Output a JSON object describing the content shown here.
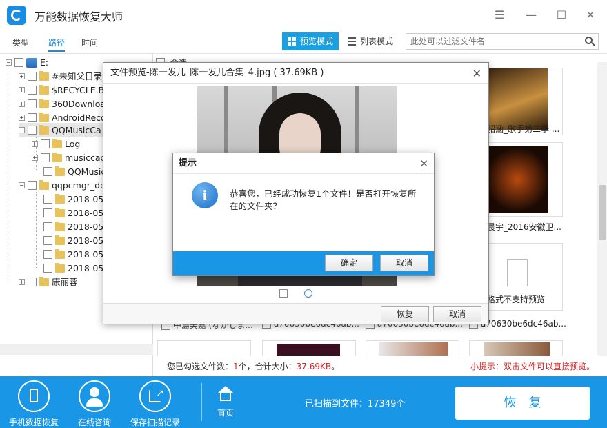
{
  "app": {
    "title": "万能数据恢复大师",
    "colors": {
      "accent": "#1a96e6",
      "warning": "#e02020"
    }
  },
  "toolbar": {
    "tabs": [
      "类型",
      "路径",
      "时间"
    ],
    "active_tab": "路径",
    "mode_preview": "预览模式",
    "mode_list": "列表模式",
    "search_placeholder": "此处可以过滤文件名"
  },
  "tree": {
    "root": "E:",
    "items": [
      "#未知父目录",
      "$RECYCLE.B",
      "360Downloa",
      "AndroidReco",
      "QQMusicCa",
      "Log",
      "musiccac",
      "QQMusic",
      "qqpcmgr_do",
      "2018-05-",
      "2018-05-",
      "2018-05-",
      "2018-05-",
      "2018-05-",
      "2018-05-",
      "康丽蓉"
    ]
  },
  "main": {
    "select_all": "全选",
    "files": [
      "陈一发儿_陈一发儿合集_4.jpg",
      "韶涵_歌手第二季 ...",
      "晨宇_2016安徽卫...",
      "格式不支持预览",
      "中島美嘉 (なかしま...",
      "a70630be6dc46ab...",
      "a70630be6dc46ab...",
      "a70630be6dc46ab..."
    ]
  },
  "status": {
    "selected_prefix": "您已勾选文件数：",
    "selected_count": "1",
    "selected_mid": "个，合计大小：",
    "selected_size": "37.69KB",
    "selected_suffix": "。",
    "tip": "小提示：双击文件可以直接预览。"
  },
  "bottom": {
    "phone_recovery": "手机数据恢复",
    "online_consult": "在线咨询",
    "save_scan": "保存扫描记录",
    "home": "首页",
    "scanned": "已扫描到文件：17349个",
    "recover": "恢复"
  },
  "preview_dialog": {
    "title": "文件预览-陈一发儿_陈一发儿合集_4.jpg ( 37.69KB )",
    "recover": "恢复",
    "cancel": "取消"
  },
  "prompt_dialog": {
    "title": "提示",
    "message": "恭喜您，已经成功恢复1个文件！是否打开恢复所在的文件夹？",
    "ok": "确定",
    "cancel": "取消"
  }
}
